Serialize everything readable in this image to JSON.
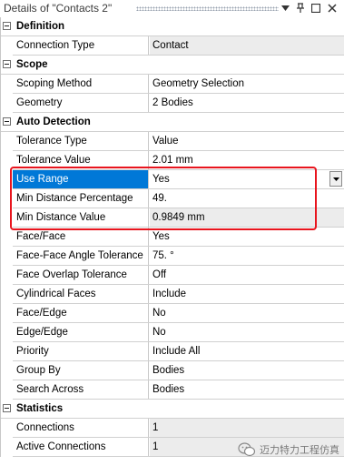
{
  "window": {
    "title": "Details of \"Contacts 2\"",
    "buttons": [
      {
        "name": "pin-icon",
        "glyph": "▾"
      },
      {
        "name": "pushpin-icon",
        "glyph": "⊥"
      },
      {
        "name": "maximize-icon",
        "glyph": "□"
      },
      {
        "name": "close-icon",
        "glyph": "×"
      }
    ]
  },
  "groups": {
    "definition": "Definition",
    "scope": "Scope",
    "auto_detection": "Auto Detection",
    "statistics": "Statistics"
  },
  "rows": {
    "connection_type": {
      "label": "Connection Type",
      "value": "Contact"
    },
    "scoping_method": {
      "label": "Scoping Method",
      "value": "Geometry Selection"
    },
    "geometry": {
      "label": "Geometry",
      "value": "2 Bodies"
    },
    "tolerance_type": {
      "label": "Tolerance Type",
      "value": "Value"
    },
    "tolerance_value": {
      "label": "Tolerance Value",
      "value": "2.01 mm"
    },
    "use_range": {
      "label": "Use Range",
      "value": "Yes"
    },
    "min_distance_percentage": {
      "label": "Min Distance Percentage",
      "value": "49."
    },
    "min_distance_value": {
      "label": "Min Distance Value",
      "value": "0.9849 mm"
    },
    "face_face": {
      "label": "Face/Face",
      "value": "Yes"
    },
    "face_face_angle_tolerance": {
      "label": "Face-Face Angle Tolerance",
      "value": "75. °"
    },
    "face_overlap_tolerance": {
      "label": "Face Overlap Tolerance",
      "value": "Off"
    },
    "cylindrical_faces": {
      "label": "Cylindrical Faces",
      "value": "Include"
    },
    "face_edge": {
      "label": "Face/Edge",
      "value": "No"
    },
    "edge_edge": {
      "label": "Edge/Edge",
      "value": "No"
    },
    "priority": {
      "label": "Priority",
      "value": "Include All"
    },
    "group_by": {
      "label": "Group By",
      "value": "Bodies"
    },
    "search_across": {
      "label": "Search Across",
      "value": "Bodies"
    },
    "connections": {
      "label": "Connections",
      "value": "1"
    },
    "active_connections": {
      "label": "Active Connections",
      "value": "1"
    }
  },
  "watermark": {
    "text": "迈力特力工程仿真"
  },
  "colors": {
    "selection": "#0078d7",
    "highlight_box": "#e8151e",
    "readonly_value_bg": "#ececec"
  }
}
